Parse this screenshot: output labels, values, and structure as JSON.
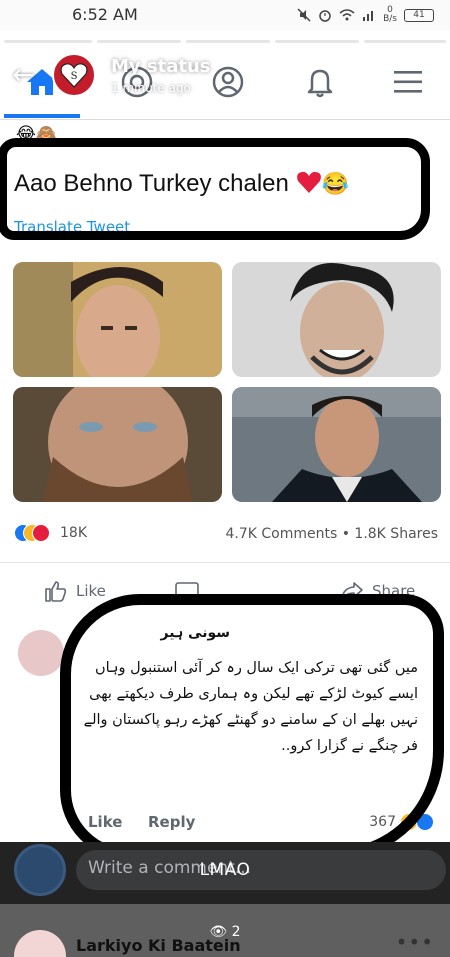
{
  "status_bar": {
    "time": "6:52 AM",
    "speed": "0",
    "speed_unit": "B/s",
    "battery": "41"
  },
  "status": {
    "title": "My status",
    "subtitle": "1 minute ago"
  },
  "post": {
    "emojis": "😂🙈",
    "text": "Aao Behno Turkey chalen",
    "emoji_suffix": "😂",
    "translate": "Translate Tweet",
    "reaction_count": "18K",
    "comments_shares": "4.7K Comments • 1.8K Shares"
  },
  "actions": {
    "like": "Like",
    "share": "Share"
  },
  "comment": {
    "name": "سونی ہیر",
    "body": "میں گئی تھی ترکی ایک سال رہ کر آئی استنبول وہاں ایسے کیوٹ لڑکے تھے لیکن وہ ہماری طرف دیکھتے بھی نہیں بھلے ان کے سامنے دو گھنٹے کھڑے رہو پاکستان والے فر چنگے نے گزارا کرو..",
    "like": "Like",
    "reply": "Reply",
    "reaction_count": "367"
  },
  "write_comment": {
    "placeholder": "Write a comment...",
    "caption": "LMAO"
  },
  "next_post": {
    "title": "Larkiyo Ki Baatein",
    "viewers": "2",
    "menu": "•••"
  },
  "colors": {
    "facebook_blue": "#1877f2",
    "heart_red": "#e41e3f",
    "reply_bar": "#232323"
  }
}
